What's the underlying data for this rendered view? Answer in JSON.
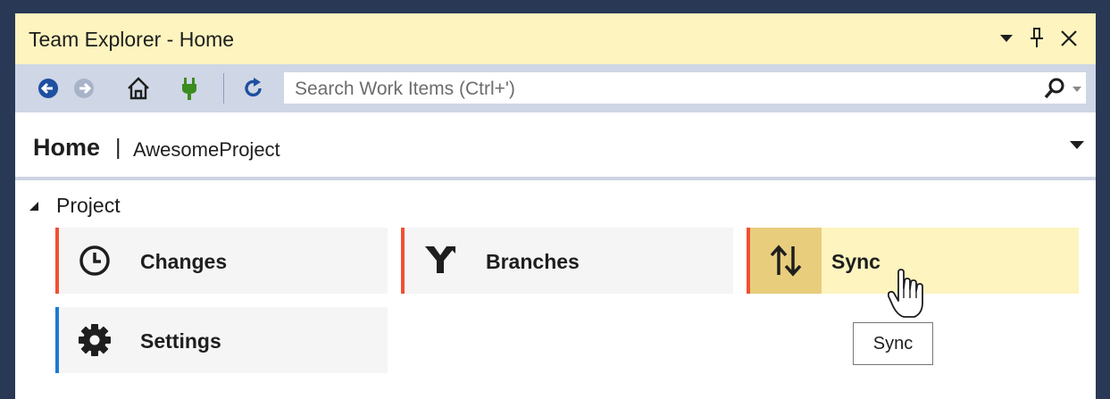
{
  "titlebar": {
    "title": "Team Explorer - Home",
    "buttons": [
      "chevron-down-icon",
      "pin-icon",
      "close-icon"
    ]
  },
  "toolbar": {
    "items": [
      "back-arrow-icon",
      "forward-arrow-icon",
      "home-icon",
      "connect-plug-icon",
      "refresh-icon"
    ],
    "search": {
      "placeholder": "Search Work Items (Ctrl+')",
      "value": ""
    }
  },
  "home": {
    "title": "Home",
    "separator": "|",
    "project": "AwesomeProject"
  },
  "section": {
    "label": "Project"
  },
  "tiles": [
    {
      "label": "Changes",
      "icon": "clock-icon",
      "accent": "#f05133"
    },
    {
      "label": "Branches",
      "icon": "branch-icon",
      "accent": "#f05133"
    },
    {
      "label": "Sync",
      "icon": "sync-arrows-icon",
      "accent": "#f05133",
      "hover": true
    },
    {
      "label": "Settings",
      "icon": "gear-icon",
      "accent": "#1e79d4"
    }
  ],
  "tooltip": "Sync",
  "colors": {
    "titlebar_bg": "#fdf4bf",
    "toolbar_bg": "#cfd6e5",
    "frame_bg": "#293955",
    "accent_red": "#f05133",
    "accent_blue": "#1e79d4",
    "hover_icon_bg": "#e8cd7d"
  }
}
